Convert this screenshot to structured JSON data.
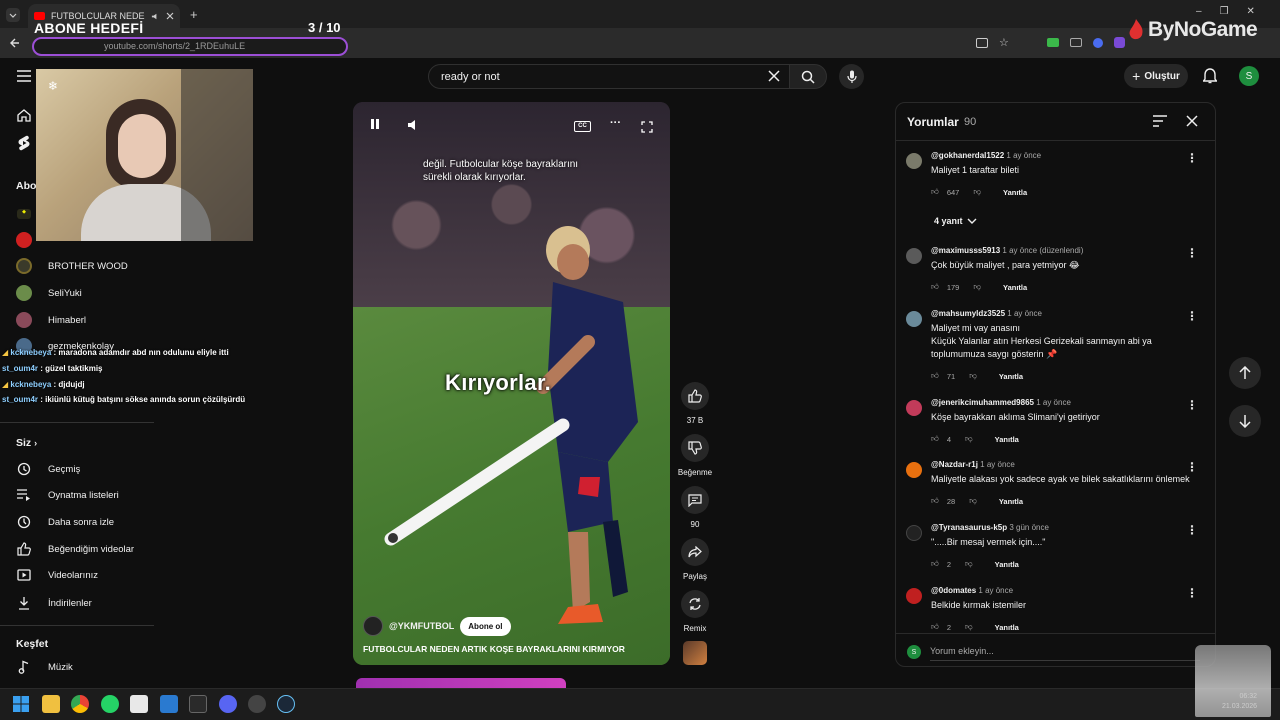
{
  "browser": {
    "tab_title": "FUTBOLCULAR NEDEN ARTI",
    "url": "youtube.com/shorts/2_1RDEuhuLE"
  },
  "overlay": {
    "goal_title": "ABONE HEDEFİ",
    "goal_progress": "3  / 10",
    "brand": "ByNoGame"
  },
  "header": {
    "search_value": "ready or not",
    "create_label": "Oluştur",
    "avatar_letter": "S"
  },
  "sidebar": {
    "subscriptions_partial": "Abo",
    "subs": [
      {
        "label": "BROTHER WOOD",
        "color": "#3a3a2a"
      },
      {
        "label": "SeliYuki",
        "color": "#6b8c4a"
      },
      {
        "label": "Himaberl",
        "color": "#8a4a5a"
      },
      {
        "label": "gezmekenkolay",
        "color": "#4a6a8a"
      }
    ],
    "you_header": "Siz",
    "you_items": [
      {
        "label": "Geçmiş",
        "icon": "history-icon"
      },
      {
        "label": "Oynatma listeleri",
        "icon": "playlists-icon"
      },
      {
        "label": "Daha sonra izle",
        "icon": "watch-later-icon"
      },
      {
        "label": "Beğendiğim videolar",
        "icon": "liked-icon"
      },
      {
        "label": "Videolarınız",
        "icon": "your-videos-icon"
      },
      {
        "label": "İndirilenler",
        "icon": "downloads-icon"
      }
    ],
    "explore_header": "Keşfet",
    "explore_items": [
      {
        "label": "Müzik",
        "icon": "music-icon"
      }
    ]
  },
  "chat": [
    {
      "user": "kcknebeya",
      "msg": ": maradona adamdır abd nın odulunu eliyle itti"
    },
    {
      "user": "st_oum4r",
      "msg": ": güzel taktikmiş"
    },
    {
      "user": "kcknebeya",
      "msg": ": djdujdj"
    },
    {
      "user": "st_oum4r",
      "msg": ": ikiünlü kütuğ batşını sökse anında sorun çözülşürdü"
    }
  ],
  "video": {
    "caption_top_line1": "değil. Futbolcular köşe bayraklarını",
    "caption_top_line2": "sürekli olarak kırıyorlar.",
    "caption_big": "Kırıyorlar.",
    "channel": "@YKMFUTBOL",
    "subscribe_label": "Abone ol",
    "title": "FUTBOLCULAR NEDEN ARTIK KOŞE BAYRAKLARINI KIRMIYOR"
  },
  "actions": {
    "like_count": "37 B",
    "dislike_label": "Beğenme",
    "comment_count": "90",
    "share_label": "Paylaş",
    "remix_label": "Remix"
  },
  "comments": {
    "title": "Yorumlar",
    "count": "90",
    "reply_label": "Yanıtla",
    "replies_toggle": "4 yanıt",
    "add_placeholder": "Yorum ekleyin...",
    "items": [
      {
        "user": "@gokhanerdal1522",
        "time": "1 ay önce",
        "text": "Maliyet 1 taraftar bileti",
        "likes": "647",
        "color": "#7a7a6a"
      },
      {
        "user": "@maximusss5913",
        "time": "1 ay önce (düzenlendi)",
        "text": "Çok büyük maliyet , para yetmiyor 😂",
        "likes": "179",
        "color": "#5a5a5a"
      },
      {
        "user": "@mahsumyldz3525",
        "time": "1 ay önce",
        "text": "Maliyet mi vay anasını\nKüçük Yalanlar atın Herkesi Gerizekali sanmayın abi ya toplumumuza saygı gösterin 📌",
        "likes": "71",
        "color": "#6a8a9a"
      },
      {
        "user": "@jenerikcimuhammed9865",
        "time": "1 ay önce",
        "text": "Köşe bayrakkarı aklıma Slimani'yi getiriyor",
        "likes": "4",
        "color": "#c23b5a"
      },
      {
        "user": "@Nazdar-r1j",
        "time": "1 ay önce",
        "text": "Maliyetle alakası yok sadece ayak ve bilek sakatlıklarını önlemek",
        "likes": "28",
        "color": "#e8700f"
      },
      {
        "user": "@Tyranasaurus-k5p",
        "time": "3 gün önce",
        "text": "\".....Bir mesaj vermek için....\"",
        "likes": "2",
        "color": "#222222"
      },
      {
        "user": "@0domates",
        "time": "1 ay önce",
        "text": "Belkide kırmak istemiler",
        "likes": "2",
        "color": "#c02020"
      }
    ]
  },
  "clock": {
    "time": "06:32",
    "date": "21.03.2026"
  },
  "colors": {
    "accent_green": "#1e8e3e",
    "omnibox_border": "#9c4fd6"
  }
}
